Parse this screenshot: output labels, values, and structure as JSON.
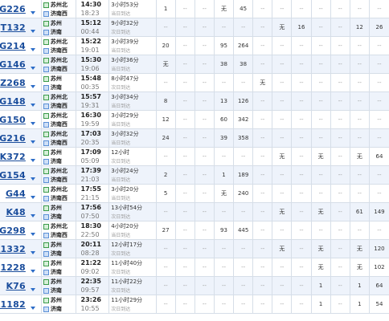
{
  "trains": [
    {
      "no": "G226",
      "from": "苏州北",
      "to": "济南西",
      "from_icon": "pass",
      "dep": "14:30",
      "arr": "18:23",
      "dur": "3小时53分",
      "day": "当日到达",
      "seats": [
        "1",
        "--",
        "--",
        "无",
        "45",
        "--",
        "--",
        "--",
        "--",
        "--",
        "--",
        "--"
      ]
    },
    {
      "no": "T132",
      "from": "苏州",
      "to": "济南",
      "from_icon": "pass",
      "dep": "15:12",
      "arr": "00:44",
      "dur": "9小时32分",
      "day": "次日到达",
      "seats": [
        "--",
        "--",
        "--",
        "--",
        "--",
        "--",
        "无",
        "16",
        "--",
        "--",
        "12",
        "26"
      ]
    },
    {
      "no": "G214",
      "from": "苏州北",
      "to": "济南西",
      "from_icon": "pass",
      "dep": "15:22",
      "arr": "19:01",
      "dur": "3小时39分",
      "day": "当日到达",
      "seats": [
        "20",
        "--",
        "--",
        "95",
        "264",
        "--",
        "--",
        "--",
        "--",
        "--",
        "--",
        "--"
      ]
    },
    {
      "no": "G146",
      "from": "苏州北",
      "to": "济南西",
      "from_icon": "pass",
      "dep": "15:30",
      "arr": "19:06",
      "dur": "3小时36分",
      "day": "当日到达",
      "seats": [
        "无",
        "--",
        "--",
        "38",
        "38",
        "--",
        "--",
        "--",
        "--",
        "--",
        "--",
        "--"
      ]
    },
    {
      "no": "Z268",
      "from": "苏州",
      "to": "济南",
      "from_icon": "pass",
      "dep": "15:48",
      "arr": "00:35",
      "dur": "8小时47分",
      "day": "次日到达",
      "seats": [
        "--",
        "--",
        "--",
        "--",
        "--",
        "无",
        "--",
        "--",
        "--",
        "--",
        "--",
        "--"
      ]
    },
    {
      "no": "G148",
      "from": "苏州北",
      "to": "济南西",
      "from_icon": "pass",
      "dep": "15:57",
      "arr": "19:31",
      "dur": "3小时34分",
      "day": "当日到达",
      "seats": [
        "8",
        "--",
        "--",
        "13",
        "126",
        "--",
        "--",
        "--",
        "--",
        "--",
        "--",
        "--"
      ]
    },
    {
      "no": "G150",
      "from": "苏州北",
      "to": "济南西",
      "from_icon": "pass",
      "dep": "16:30",
      "arr": "19:59",
      "dur": "3小时29分",
      "day": "当日到达",
      "seats": [
        "12",
        "--",
        "--",
        "60",
        "342",
        "--",
        "--",
        "--",
        "--",
        "--",
        "--",
        "--"
      ]
    },
    {
      "no": "G216",
      "from": "苏州北",
      "to": "济南西",
      "from_icon": "pass",
      "dep": "17:03",
      "arr": "20:35",
      "dur": "3小时32分",
      "day": "当日到达",
      "seats": [
        "24",
        "--",
        "--",
        "39",
        "358",
        "--",
        "--",
        "--",
        "--",
        "--",
        "--",
        "--"
      ]
    },
    {
      "no": "K372",
      "from": "苏州",
      "to": "济南",
      "from_icon": "pass",
      "dep": "17:09",
      "arr": "05:09",
      "dur": "12小时",
      "day": "次日到达",
      "seats": [
        "--",
        "--",
        "--",
        "--",
        "--",
        "--",
        "无",
        "--",
        "无",
        "--",
        "无",
        "64"
      ]
    },
    {
      "no": "G154",
      "from": "苏州北",
      "to": "济南西",
      "from_icon": "pass",
      "dep": "17:39",
      "arr": "21:03",
      "dur": "3小时24分",
      "day": "当日到达",
      "seats": [
        "2",
        "--",
        "--",
        "1",
        "189",
        "--",
        "--",
        "--",
        "--",
        "--",
        "--",
        "--"
      ]
    },
    {
      "no": "G44",
      "from": "苏州北",
      "to": "济南西",
      "from_icon": "pass",
      "dep": "17:55",
      "arr": "21:15",
      "dur": "3小时20分",
      "day": "当日到达",
      "seats": [
        "5",
        "--",
        "--",
        "无",
        "240",
        "--",
        "--",
        "--",
        "--",
        "--",
        "--",
        "--"
      ]
    },
    {
      "no": "K48",
      "from": "苏州",
      "to": "济南",
      "from_icon": "pass",
      "dep": "17:56",
      "arr": "07:50",
      "dur": "13小时54分",
      "day": "次日到达",
      "seats": [
        "--",
        "--",
        "--",
        "--",
        "--",
        "--",
        "无",
        "--",
        "无",
        "--",
        "61",
        "149"
      ]
    },
    {
      "no": "G298",
      "from": "苏州北",
      "to": "济南西",
      "from_icon": "pass",
      "dep": "18:30",
      "arr": "22:50",
      "dur": "4小时20分",
      "day": "当日到达",
      "seats": [
        "27",
        "--",
        "--",
        "93",
        "445",
        "--",
        "--",
        "--",
        "--",
        "--",
        "--",
        "--"
      ]
    },
    {
      "no": "K1332",
      "from": "苏州",
      "to": "济南",
      "from_icon": "pass",
      "dep": "20:11",
      "arr": "08:28",
      "dur": "12小时17分",
      "day": "次日到达",
      "seats": [
        "--",
        "--",
        "--",
        "--",
        "--",
        "--",
        "无",
        "--",
        "无",
        "--",
        "无",
        "120"
      ]
    },
    {
      "no": "1228",
      "from": "苏州",
      "to": "济南",
      "from_icon": "pass",
      "dep": "21:22",
      "arr": "09:02",
      "dur": "11小时40分",
      "day": "次日到达",
      "seats": [
        "--",
        "--",
        "--",
        "--",
        "--",
        "--",
        "--",
        "--",
        "无",
        "--",
        "无",
        "102"
      ]
    },
    {
      "no": "K76",
      "from": "苏州",
      "to": "济南",
      "from_icon": "pass",
      "dep": "22:35",
      "arr": "09:57",
      "dur": "11小时22分",
      "day": "次日到达",
      "seats": [
        "--",
        "--",
        "--",
        "--",
        "--",
        "--",
        "--",
        "--",
        "1",
        "--",
        "1",
        "64"
      ]
    },
    {
      "no": "K1182",
      "from": "苏州",
      "to": "济南",
      "from_icon": "pass",
      "dep": "23:26",
      "arr": "10:55",
      "dur": "11小时29分",
      "day": "次日到达",
      "seats": [
        "--",
        "--",
        "--",
        "--",
        "--",
        "--",
        "--",
        "--",
        "1",
        "--",
        "1",
        "54"
      ]
    }
  ],
  "colors": {
    "train_no": "#1a4d9c",
    "row_alt": "#eef3fb",
    "grid": "#d6dee8",
    "muted": "#999999"
  },
  "icons": {
    "station_from": "station-start-icon",
    "station_to": "station-end-icon",
    "dropdown": "chevron-down-icon"
  }
}
